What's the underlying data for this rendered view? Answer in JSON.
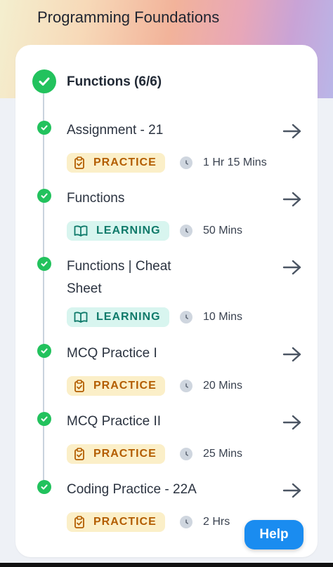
{
  "header": {
    "title": "Programming Foundations"
  },
  "section": {
    "title": "Functions (6/6)"
  },
  "items": [
    {
      "title": "Assignment - 21",
      "type": "PRACTICE",
      "duration": "1 Hr 15 Mins"
    },
    {
      "title": "Functions",
      "type": "LEARNING",
      "duration": "50 Mins"
    },
    {
      "title": "Functions | Cheat Sheet",
      "type": "LEARNING",
      "duration": "10 Mins"
    },
    {
      "title": "MCQ Practice I",
      "type": "PRACTICE",
      "duration": "20 Mins"
    },
    {
      "title": "MCQ Practice II",
      "type": "PRACTICE",
      "duration": "25 Mins"
    },
    {
      "title": "Coding Practice - 22A",
      "type": "PRACTICE",
      "duration": "2 Hrs"
    }
  ],
  "help": {
    "label": "Help"
  },
  "colors": {
    "complete": "#22c25d",
    "practice_bg": "#fbefc8",
    "learning_bg": "#d8f5ef",
    "help": "#1a8cf0"
  },
  "icons": {
    "check": "check-icon",
    "arrow": "arrow-right-icon",
    "practice": "clipboard-check-icon",
    "learning": "open-book-icon",
    "clock": "clock-icon"
  }
}
